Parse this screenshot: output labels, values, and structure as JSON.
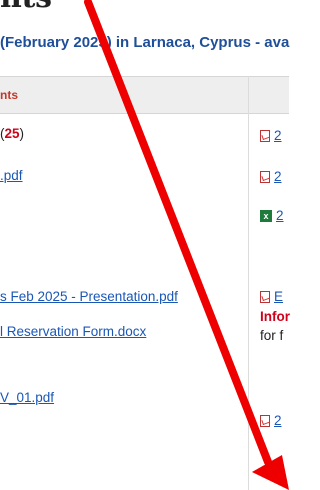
{
  "page": {
    "heading": "nts",
    "subtitle": "(February 2025) in Larnaca, Cyprus - ava"
  },
  "table": {
    "header": "nts",
    "rows": [
      {
        "left_prefix": "(",
        "left_red": "25",
        "left_suffix": ")",
        "right_icon": "pdf-icon",
        "right_text": "2"
      },
      {
        "left_link": ".pdf",
        "right_icon": "pdf-icon",
        "right_text": "2"
      },
      {
        "right_icon": "excel-icon",
        "right_text": "2"
      },
      {
        "left_link": "s Feb 2025 - Presentation.pdf",
        "right_icon": "pdf-icon",
        "right_text": "E"
      },
      {
        "left_link": "l Reservation Form.docx",
        "right_red": "Infor",
        "right_plain": "for f"
      },
      {
        "left_link": "V_01.pdf",
        "right_icon": "pdf-icon",
        "right_text": "2"
      }
    ]
  },
  "colors": {
    "link": "#1a57b5",
    "accent_red": "#d0021b",
    "header_bg": "#eeeeee",
    "arrow": "#ee0000"
  }
}
